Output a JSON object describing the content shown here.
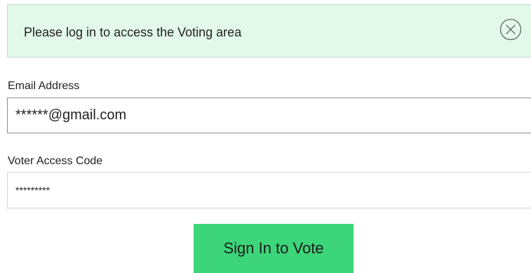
{
  "alert": {
    "message": "Please log in to access the Voting area",
    "close_icon": "circle-x-icon"
  },
  "form": {
    "email_label": "Email Address",
    "email_value": "******@gmail.com",
    "code_label": "Voter Access Code",
    "code_value": "*********",
    "submit_label": "Sign In to Vote"
  },
  "colors": {
    "alert_background": "#e2f8e9",
    "alert_border": "#c4dccd",
    "button_background": "#3dd57a",
    "text": "#222222"
  }
}
